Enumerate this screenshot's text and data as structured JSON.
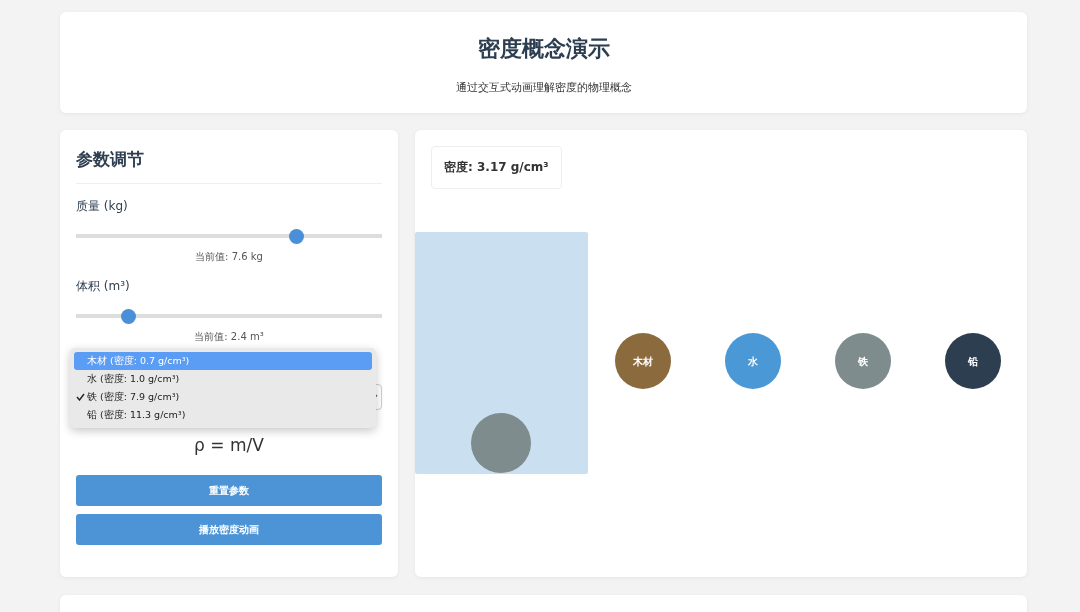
{
  "header": {
    "title": "密度概念演示",
    "subtitle": "通过交互式动画理解密度的物理概念"
  },
  "controls": {
    "title": "参数调节",
    "sliders": [
      {
        "label": "质量 (kg)",
        "level": 0.72,
        "reading": "当前值: 7.6 kg"
      },
      {
        "label": "体积 (m³)",
        "level": 0.17,
        "reading": "当前值: 2.4 m³"
      }
    ],
    "material_menu": {
      "options": [
        {
          "label": "木材 (密度: 0.7 g/cm³)",
          "highlighted": true,
          "checked": false
        },
        {
          "label": "水 (密度: 1.0 g/cm³)",
          "highlighted": false,
          "checked": false
        },
        {
          "label": "铁 (密度: 7.9 g/cm³)",
          "highlighted": false,
          "checked": true
        },
        {
          "label": "铅 (密度: 11.3 g/cm³)",
          "highlighted": false,
          "checked": false
        }
      ]
    },
    "formula": "ρ = m/V",
    "buttons": [
      "重置参数",
      "播放密度动画"
    ]
  },
  "stage": {
    "density": "密度: 3.17 g/cm³",
    "tank_object": {
      "color": "#7f8c8d"
    },
    "materials": [
      {
        "label": "木材",
        "color": "#8b6b3e"
      },
      {
        "label": "水",
        "color": "#4a98d6"
      },
      {
        "label": "铁",
        "color": "#7f8c8d"
      },
      {
        "label": "铅",
        "color": "#2c3e50"
      }
    ]
  }
}
